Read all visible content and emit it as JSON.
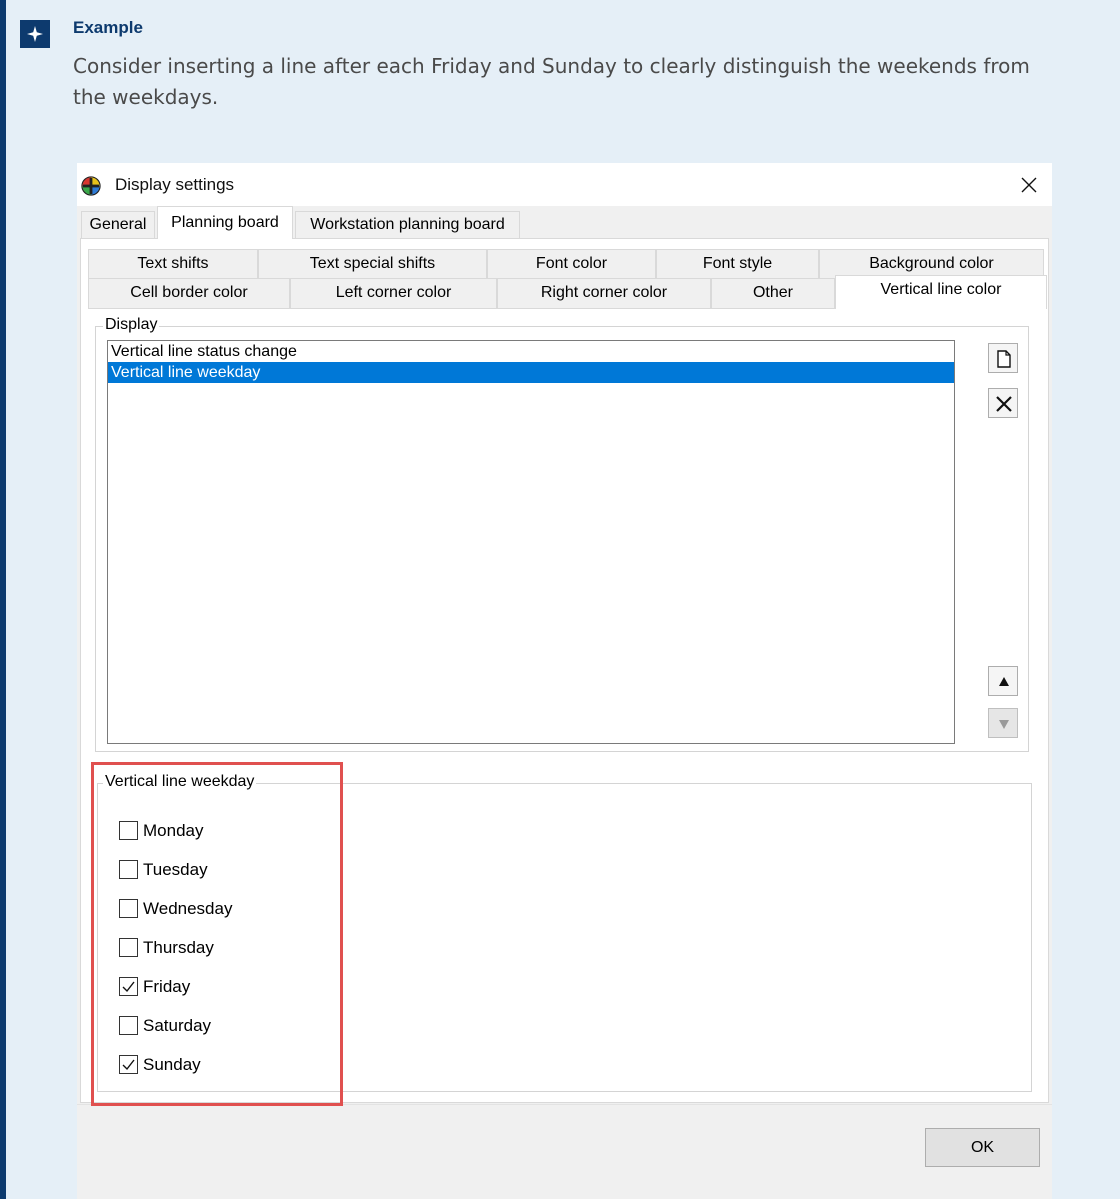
{
  "callout": {
    "title": "Example",
    "text": "Consider inserting a line after each Friday and Sunday to clearly distinguish the weekends from the weekdays."
  },
  "dialog": {
    "title": "Display settings",
    "main_tabs": [
      {
        "label": "General",
        "selected": false
      },
      {
        "label": "Planning board",
        "selected": true
      },
      {
        "label": "Workstation planning board",
        "selected": false
      }
    ],
    "sub_tabs_row1": [
      {
        "label": "Text shifts"
      },
      {
        "label": "Text special shifts"
      },
      {
        "label": "Font color"
      },
      {
        "label": "Font style"
      },
      {
        "label": "Background color"
      }
    ],
    "sub_tabs_row2": [
      {
        "label": "Cell border color",
        "selected": false
      },
      {
        "label": "Left corner color",
        "selected": false
      },
      {
        "label": "Right corner color",
        "selected": false
      },
      {
        "label": "Other",
        "selected": false
      },
      {
        "label": "Vertical line color",
        "selected": true
      }
    ],
    "display_group": {
      "label": "Display",
      "items": [
        {
          "label": "Vertical line status change",
          "selected": false
        },
        {
          "label": "Vertical line weekday",
          "selected": true
        }
      ]
    },
    "weekday_group": {
      "label": "Vertical line weekday",
      "days": [
        {
          "label": "Monday",
          "checked": false
        },
        {
          "label": "Tuesday",
          "checked": false
        },
        {
          "label": "Wednesday",
          "checked": false
        },
        {
          "label": "Thursday",
          "checked": false
        },
        {
          "label": "Friday",
          "checked": true
        },
        {
          "label": "Saturday",
          "checked": false
        },
        {
          "label": "Sunday",
          "checked": true
        }
      ]
    },
    "ok_label": "OK"
  },
  "colors": {
    "callout_accent": "#0d3a6e",
    "selection": "#0078d7",
    "highlight": "#e0504f"
  }
}
